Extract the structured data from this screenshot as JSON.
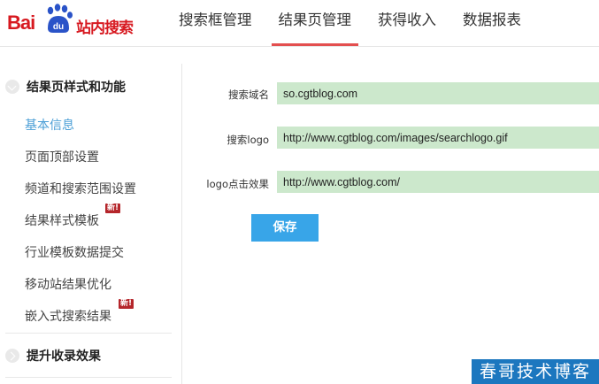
{
  "logo": {
    "bai": "Bai",
    "du": "du",
    "product": "站内搜索"
  },
  "nav": [
    {
      "label": "搜索框管理"
    },
    {
      "label": "结果页管理"
    },
    {
      "label": "获得收入"
    },
    {
      "label": "数据报表"
    }
  ],
  "sidebar": {
    "section1": "结果页样式和功能",
    "items": [
      {
        "label": "基本信息"
      },
      {
        "label": "页面顶部设置"
      },
      {
        "label": "频道和搜索范围设置"
      },
      {
        "label": "结果样式模板"
      },
      {
        "label": "行业模板数据提交"
      },
      {
        "label": "移动站结果优化"
      },
      {
        "label": "嵌入式搜索结果"
      }
    ],
    "new_badge": "新!",
    "section2": "提升收录效果"
  },
  "form": {
    "domain_label": "搜索域名",
    "domain_value": "so.cgtblog.com",
    "logo_label": "搜索logo",
    "logo_value": "http://www.cgtblog.com/images/searchlogo.gif",
    "click_label": "logo点击效果",
    "click_value": "http://www.cgtblog.com/",
    "save_label": "保存"
  },
  "watermark": "春哥技术博客",
  "colors": {
    "brand_red": "#d71920",
    "logo_blue": "#2a53c8",
    "active_tab_underline": "#e34f4f",
    "active_link": "#4a9ed6",
    "input_bg": "#cce8cc",
    "save_button": "#38a5e8",
    "watermark_bg": "#1c77bf"
  }
}
